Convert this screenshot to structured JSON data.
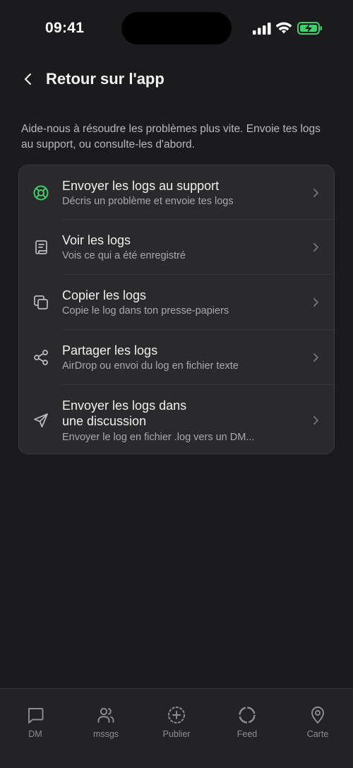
{
  "status_bar": {
    "time": "09:41"
  },
  "header": {
    "title": "Retour sur l'app"
  },
  "intro": "Aide-nous à résoudre les problèmes plus vite. Envoie tes logs au support, ou consulte-les d'abord.",
  "colors": {
    "accent": "#3ecf6c",
    "background": "#1b1b1e",
    "card": "#2a2a2d"
  },
  "options": [
    {
      "icon": "lifebuoy-icon",
      "title": "Envoyer les logs au support",
      "subtitle": "Décris un problème et envoie tes logs"
    },
    {
      "icon": "scroll-icon",
      "title": "Voir les logs",
      "subtitle": "Vois ce qui a été enregistré"
    },
    {
      "icon": "copy-icon",
      "title": "Copier les logs",
      "subtitle": "Copie le log dans ton presse-papiers"
    },
    {
      "icon": "share-icon",
      "title": "Partager les logs",
      "subtitle": "AirDrop ou envoi du log en fichier texte"
    },
    {
      "icon": "send-icon",
      "title_line1": "Envoyer les logs dans",
      "title_line2": "une discussion",
      "subtitle": "Envoyer le log en fichier .log vers un DM..."
    }
  ],
  "tabs": [
    {
      "icon": "chat-bubble-icon",
      "label": "DM"
    },
    {
      "icon": "users-icon",
      "label": "mssgs"
    },
    {
      "icon": "plus-circle-icon",
      "label": "Publier"
    },
    {
      "icon": "circle-loader-icon",
      "label": "Feed"
    },
    {
      "icon": "map-pin-icon",
      "label": "Carte"
    }
  ]
}
